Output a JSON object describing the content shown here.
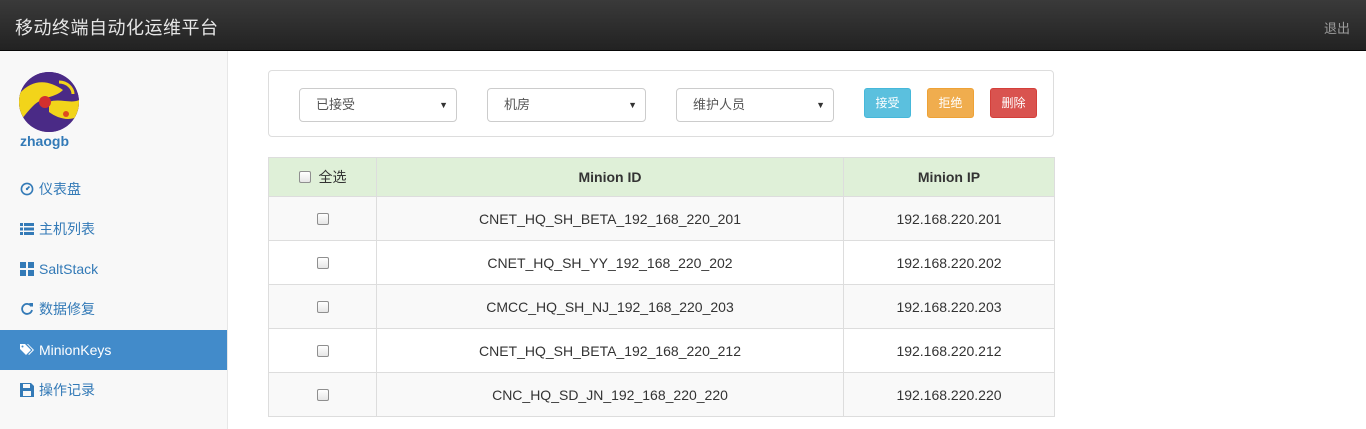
{
  "app": {
    "title": "移动终端自动化运维平台",
    "logout_label": "退出"
  },
  "user": {
    "name": "zhaogb"
  },
  "sidebar": {
    "items": [
      {
        "label": "仪表盘",
        "icon": "dashboard-icon"
      },
      {
        "label": "主机列表",
        "icon": "list-icon"
      },
      {
        "label": "SaltStack",
        "icon": "grid-icon"
      },
      {
        "label": "数据修复",
        "icon": "refresh-icon"
      },
      {
        "label": "MinionKeys",
        "icon": "tags-icon",
        "active": true
      },
      {
        "label": "操作记录",
        "icon": "save-icon"
      }
    ]
  },
  "filters": {
    "status": "已接受",
    "room": "机房",
    "maintainer": "维护人员"
  },
  "actions": {
    "accept": "接受",
    "reject": "拒绝",
    "delete": "删除"
  },
  "table": {
    "select_all": "全选",
    "columns": [
      "Minion ID",
      "Minion IP"
    ],
    "rows": [
      {
        "id": "CNET_HQ_SH_BETA_192_168_220_201",
        "ip": "192.168.220.201"
      },
      {
        "id": "CNET_HQ_SH_YY_192_168_220_202",
        "ip": "192.168.220.202"
      },
      {
        "id": "CMCC_HQ_SH_NJ_192_168_220_203",
        "ip": "192.168.220.203"
      },
      {
        "id": "CNET_HQ_SH_BETA_192_168_220_212",
        "ip": "192.168.220.212"
      },
      {
        "id": "CNC_HQ_SD_JN_192_168_220_220",
        "ip": "192.168.220.220"
      }
    ]
  },
  "colors": {
    "accent": "#428bca",
    "link": "#337ab7",
    "header_bg": "#dff0d8"
  }
}
